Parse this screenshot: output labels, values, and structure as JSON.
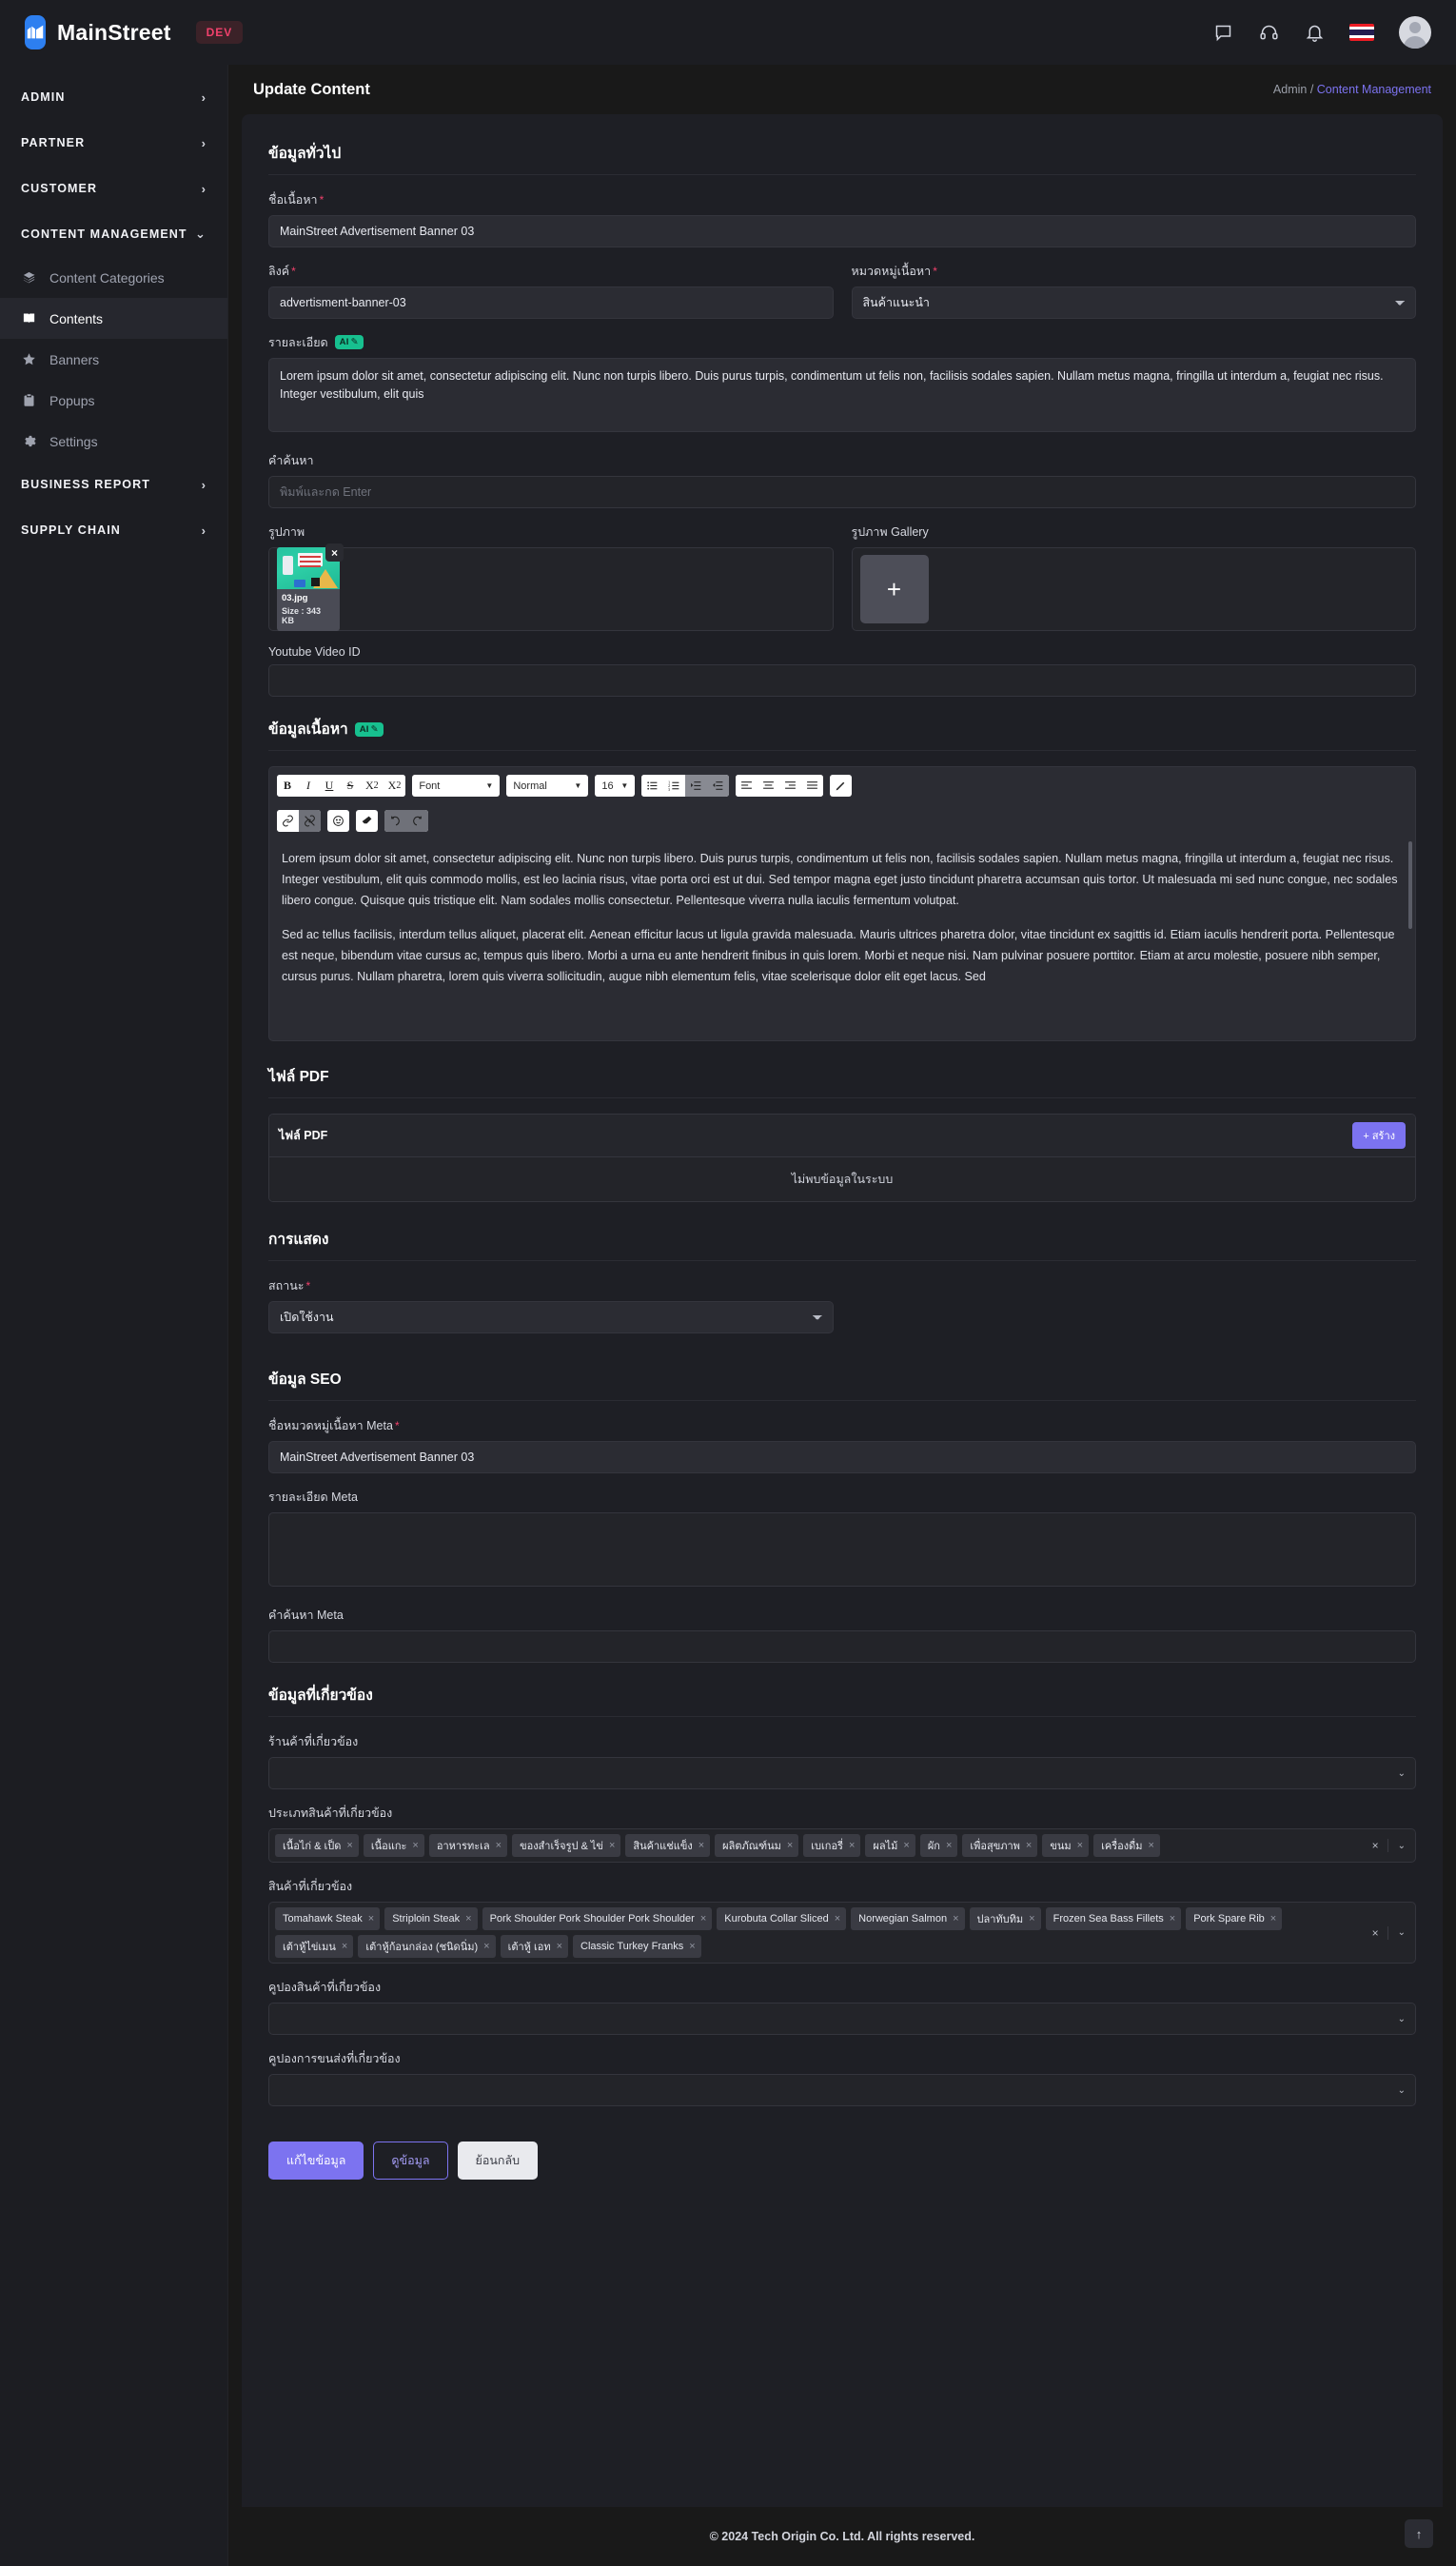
{
  "brand": {
    "name": "MainStreet",
    "badge": "DEV",
    "logo_icon": "mainstreet-logo-icon"
  },
  "topbar": {
    "icons": [
      {
        "name": "chat-icon"
      },
      {
        "name": "headset-support-icon"
      },
      {
        "name": "notification-bell-icon"
      },
      {
        "name": "thai-flag-icon"
      },
      {
        "name": "user-avatar"
      }
    ]
  },
  "sidebar": {
    "sections": [
      {
        "label": "ADMIN",
        "chevron": "›",
        "expanded": false
      },
      {
        "label": "PARTNER",
        "chevron": "›",
        "expanded": false
      },
      {
        "label": "CUSTOMER",
        "chevron": "›",
        "expanded": false
      },
      {
        "label": "CONTENT MANAGEMENT",
        "chevron": "⌄",
        "expanded": true
      }
    ],
    "items": [
      {
        "label": "Content Categories",
        "icon": "layers-icon",
        "active": false
      },
      {
        "label": "Contents",
        "icon": "book-icon",
        "active": true
      },
      {
        "label": "Banners",
        "icon": "star-icon",
        "active": false
      },
      {
        "label": "Popups",
        "icon": "clipboard-icon",
        "active": false
      },
      {
        "label": "Settings",
        "icon": "gear-icon",
        "active": false
      }
    ],
    "sections_bottom": [
      {
        "label": "BUSINESS REPORT",
        "chevron": "›"
      },
      {
        "label": "SUPPLY CHAIN",
        "chevron": "›"
      }
    ]
  },
  "page": {
    "title": "Update Content",
    "breadcrumb_root": "Admin / ",
    "breadcrumb_link": "Content Management"
  },
  "general": {
    "section_title": "ข้อมูลทั่วไป",
    "content_name_label": "ชื่อเนื้อหา",
    "content_name_value": "MainStreet Advertisement Banner 03",
    "link_label": "ลิงค์",
    "link_value": "advertisment-banner-03",
    "category_label": "หมวดหมู่เนื้อหา",
    "category_value": "สินค้าแนะนำ",
    "detail_label": "รายละเอียด",
    "ai_badge": "AI",
    "detail_value": "Lorem ipsum dolor sit amet, consectetur adipiscing elit. Nunc non turpis libero. Duis purus turpis, condimentum ut felis non, facilisis sodales sapien. Nullam metus magna, fringilla ut interdum a, feugiat nec risus. Integer vestibulum, elit quis",
    "keyword_label": "คำค้นหา",
    "keyword_placeholder": "พิมพ์และกด Enter",
    "image_label": "รูปภาพ",
    "gallery_label": "รูปภาพ Gallery",
    "image_file_name": "03.jpg",
    "image_file_size": "Size : 343 KB",
    "remove_icon": "×",
    "add_icon": "+",
    "youtube_label": "Youtube Video ID",
    "youtube_value": ""
  },
  "editor": {
    "section_title": "ข้อมูลเนื้อหา",
    "ai_badge": "AI",
    "toolbar": {
      "bold": "B",
      "italic": "I",
      "underline": "U",
      "strike": "S",
      "superscript": "X",
      "superscript_sup": "2",
      "subscript": "X",
      "subscript_sub": "2",
      "font_select": "Font",
      "style_select": "Normal",
      "size_select": "16",
      "caret": "▼",
      "icons": [
        "bullet-list-icon",
        "numbered-list-icon",
        "indent-increase-icon",
        "indent-decrease-icon",
        "align-left-icon",
        "align-center-icon",
        "align-right-icon",
        "align-justify-icon",
        "text-color-pen-icon",
        "link-icon",
        "unlink-icon",
        "emoji-icon",
        "eraser-icon",
        "undo-icon",
        "redo-icon"
      ]
    },
    "paragraphs": [
      "Lorem ipsum dolor sit amet, consectetur adipiscing elit. Nunc non turpis libero. Duis purus turpis, condimentum ut felis non, facilisis sodales sapien. Nullam metus magna, fringilla ut interdum a, feugiat nec risus. Integer vestibulum, elit quis commodo mollis, est leo lacinia risus, vitae porta orci est ut dui. Sed tempor magna eget justo tincidunt pharetra accumsan quis tortor. Ut malesuada mi sed nunc congue, nec sodales libero congue. Quisque quis tristique elit. Nam sodales mollis consectetur. Pellentesque viverra nulla iaculis fermentum volutpat.",
      "Sed ac tellus facilisis, interdum tellus aliquet, placerat elit. Aenean efficitur lacus ut ligula gravida malesuada. Mauris ultrices pharetra dolor, vitae tincidunt ex sagittis id. Etiam iaculis hendrerit porta. Pellentesque est neque, bibendum vitae cursus ac, tempus quis libero. Morbi a urna eu ante hendrerit finibus in quis lorem. Morbi et neque nisi. Nam pulvinar posuere porttitor. Etiam at arcu molestie, posuere nibh semper, cursus purus. Nullam pharetra, lorem quis viverra sollicitudin, augue nibh elementum felis, vitae scelerisque dolor elit eget lacus. Sed"
    ]
  },
  "pdf": {
    "section_title": "ไฟล์ PDF",
    "table_label": "ไฟล์ PDF",
    "create_button": "+ สร้าง",
    "empty_text": "ไม่พบข้อมูลในระบบ"
  },
  "display": {
    "section_title": "การแสดง",
    "status_label": "สถานะ",
    "status_value": "เปิดใช้งาน"
  },
  "seo": {
    "section_title": "ข้อมูล SEO",
    "meta_title_label": "ชื่อหมวดหมู่เนื้อหา Meta",
    "meta_title_value": "MainStreet Advertisement Banner 03",
    "meta_desc_label": "รายละเอียด Meta",
    "meta_desc_value": "",
    "meta_keyword_label": "คำค้นหา Meta",
    "meta_keyword_value": ""
  },
  "related": {
    "section_title": "ข้อมูลที่เกี่ยวข้อง",
    "shop_label": "ร้านค้าที่เกี่ยวข้อง",
    "shop_value": "",
    "category_label": "ประเภทสินค้าที่เกี่ยวข้อง",
    "category_tags": [
      "เนื้อไก่ & เป็ด",
      "เนื้อแกะ",
      "อาหารทะเล",
      "ของสำเร็จรูป & ไข่",
      "สินค้าแช่แข็ง",
      "ผลิตภัณฑ์นม",
      "เบเกอรี่",
      "ผลไม้",
      "ผัก",
      "เพื่อสุขภาพ",
      "ขนม",
      "เครื่องดื่ม"
    ],
    "product_label": "สินค้าที่เกี่ยวข้อง",
    "product_tags": [
      "Tomahawk Steak",
      "Striploin Steak",
      "Pork Shoulder Pork Shoulder Pork Shoulder",
      "Kurobuta Collar Sliced",
      "Norwegian Salmon",
      "ปลาทับทิม",
      "Frozen Sea Bass Fillets",
      "Pork Spare Rib",
      "เต้าหู้ไข่เมน",
      "เต้าหู้ก้อนกล่อง (ชนิดนิ่ม)",
      "เต้าหู้ เอท",
      "Classic Turkey Franks"
    ],
    "product_coupon_label": "คูปองสินค้าที่เกี่ยวข้อง",
    "product_coupon_value": "",
    "shipping_coupon_label": "คูปองการขนส่งที่เกี่ยวข้อง",
    "shipping_coupon_value": "",
    "clear_icon": "×",
    "dropdown_icon": "⌄"
  },
  "actions": {
    "save": "แก้ไขข้อมูล",
    "view": "ดูข้อมูล",
    "back": "ย้อนกลับ"
  },
  "footer": {
    "copyright": "© 2024 Tech Origin Co. Ltd. All rights reserved.",
    "to_top_icon": "↑"
  }
}
